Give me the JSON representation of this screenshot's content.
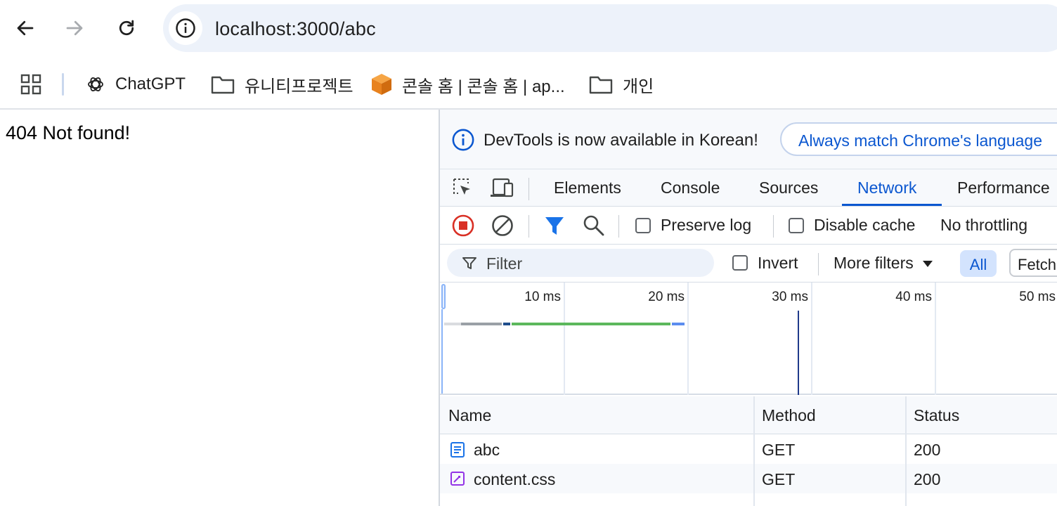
{
  "browser": {
    "url": "localhost:3000/abc",
    "bookmarks": [
      {
        "label": "ChatGPT",
        "icon": "chatgpt-icon"
      },
      {
        "label": "유니티프로젝트",
        "icon": "folder-icon"
      },
      {
        "label": "콘솔 홈 | 콘솔 홈 | ap...",
        "icon": "aws-cube-icon"
      },
      {
        "label": "개인",
        "icon": "folder-icon"
      }
    ]
  },
  "page": {
    "text": "404 Not found!"
  },
  "devtools": {
    "infobar": {
      "message": "DevTools is now available in Korean!",
      "button": "Always match Chrome's language"
    },
    "tabs": [
      "Elements",
      "Console",
      "Sources",
      "Network",
      "Performance"
    ],
    "active_tab": "Network",
    "network_toolbar": {
      "preserve_log": "Preserve log",
      "preserve_log_checked": false,
      "disable_cache": "Disable cache",
      "disable_cache_checked": false,
      "throttling": "No throttling"
    },
    "filter_bar": {
      "placeholder": "Filter",
      "invert": "Invert",
      "invert_checked": false,
      "more_filters": "More filters",
      "all": "All",
      "fetch": "Fetch"
    },
    "timeline": {
      "ticks": [
        "10 ms",
        "20 ms",
        "30 ms",
        "40 ms",
        "50 ms"
      ]
    },
    "table": {
      "columns": [
        "Name",
        "Method",
        "Status"
      ],
      "rows": [
        {
          "name": "abc",
          "method": "GET",
          "status": "200",
          "icon": "document-icon"
        },
        {
          "name": "content.css",
          "method": "GET",
          "status": "200",
          "icon": "stylesheet-icon"
        }
      ]
    }
  }
}
